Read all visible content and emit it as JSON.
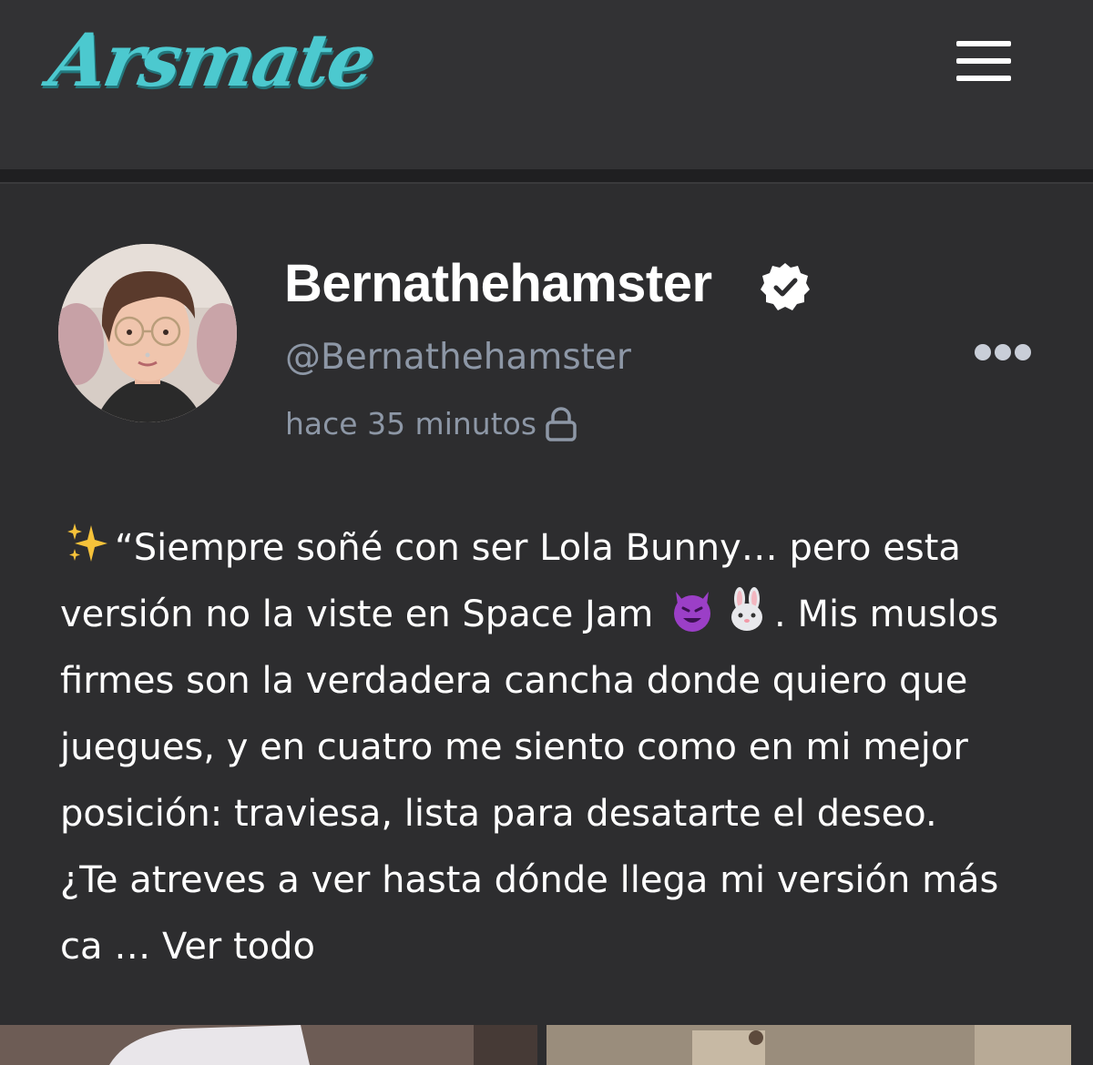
{
  "header": {
    "logo_text": "Arsmate",
    "menu_icon": "hamburger-menu-icon",
    "accent_color": "#4cc9cf"
  },
  "post": {
    "author": {
      "name": "Bernathehamster",
      "handle": "@Bernathehamster",
      "verified_icon": "verified-badge-icon"
    },
    "time": "hace 35 minutos",
    "visibility_icon": "lock-icon",
    "more_icon": "more-options-icon",
    "body": {
      "line1_text": "“Siempre soñé con ser Lola Bunny… pero esta",
      "line2_text_a": "versión no la viste en Space Jam",
      "line2_text_b": ". Mis muslos",
      "line3_text": "firmes son la verdadera cancha donde quiero que",
      "line4_text": "juegues, y en cuatro me siento como en mi mejor",
      "line5_text": "posición: traviesa, lista para desatarte el deseo.",
      "line6_text": "¿Te atreves a ver hasta dónde llega mi versión más",
      "line7_text": "ca …",
      "see_all": "Ver todo",
      "emojis": [
        "sparkles-emoji",
        "smiling-devil-emoji",
        "rabbit-emoji"
      ]
    }
  }
}
